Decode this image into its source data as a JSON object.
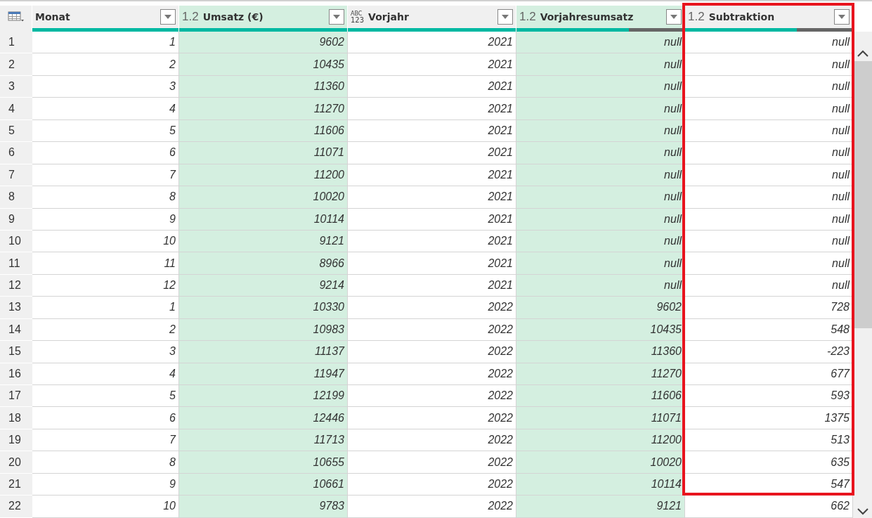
{
  "table": {
    "columns": [
      {
        "name": "Monat",
        "selected": false,
        "level": 1,
        "highlighted": false
      },
      {
        "name": "Umsatz (€)",
        "type": {
          "kind": "decimal",
          "text": "1.2"
        },
        "selected": true,
        "level": 1,
        "highlighted": false
      },
      {
        "name": "Vorjahr",
        "type": {
          "kind": "any",
          "lines": [
            "ABC",
            "123"
          ]
        },
        "selected": false,
        "level": 1,
        "highlighted": false
      },
      {
        "name": "Vorjahresumsatz",
        "type": {
          "kind": "decimal",
          "text": "1.2"
        },
        "selected": true,
        "level": 0.67,
        "highlighted": false
      },
      {
        "name": "Subtraktion",
        "type": {
          "kind": "decimal",
          "text": "1.2"
        },
        "selected": false,
        "level": 0.67,
        "highlighted": true
      }
    ],
    "rows": [
      [
        "1",
        "1",
        "9602",
        "2021",
        "null",
        "null"
      ],
      [
        "2",
        "2",
        "10435",
        "2021",
        "null",
        "null"
      ],
      [
        "3",
        "3",
        "11360",
        "2021",
        "null",
        "null"
      ],
      [
        "4",
        "4",
        "11270",
        "2021",
        "null",
        "null"
      ],
      [
        "5",
        "5",
        "11606",
        "2021",
        "null",
        "null"
      ],
      [
        "6",
        "6",
        "11071",
        "2021",
        "null",
        "null"
      ],
      [
        "7",
        "7",
        "11200",
        "2021",
        "null",
        "null"
      ],
      [
        "8",
        "8",
        "10020",
        "2021",
        "null",
        "null"
      ],
      [
        "9",
        "9",
        "10114",
        "2021",
        "null",
        "null"
      ],
      [
        "10",
        "10",
        "9121",
        "2021",
        "null",
        "null"
      ],
      [
        "11",
        "11",
        "8966",
        "2021",
        "null",
        "null"
      ],
      [
        "12",
        "12",
        "9214",
        "2021",
        "null",
        "null"
      ],
      [
        "13",
        "1",
        "10330",
        "2022",
        "9602",
        "728"
      ],
      [
        "14",
        "2",
        "10983",
        "2022",
        "10435",
        "548"
      ],
      [
        "15",
        "3",
        "11137",
        "2022",
        "11360",
        "-223"
      ],
      [
        "16",
        "4",
        "11947",
        "2022",
        "11270",
        "677"
      ],
      [
        "17",
        "5",
        "12199",
        "2022",
        "11606",
        "593"
      ],
      [
        "18",
        "6",
        "12446",
        "2022",
        "11071",
        "1375"
      ],
      [
        "19",
        "7",
        "11713",
        "2022",
        "11200",
        "513"
      ],
      [
        "20",
        "8",
        "10655",
        "2022",
        "10020",
        "635"
      ],
      [
        "21",
        "9",
        "10661",
        "2022",
        "10114",
        "547"
      ],
      [
        "22",
        "10",
        "9783",
        "2022",
        "9121",
        "662"
      ]
    ]
  }
}
